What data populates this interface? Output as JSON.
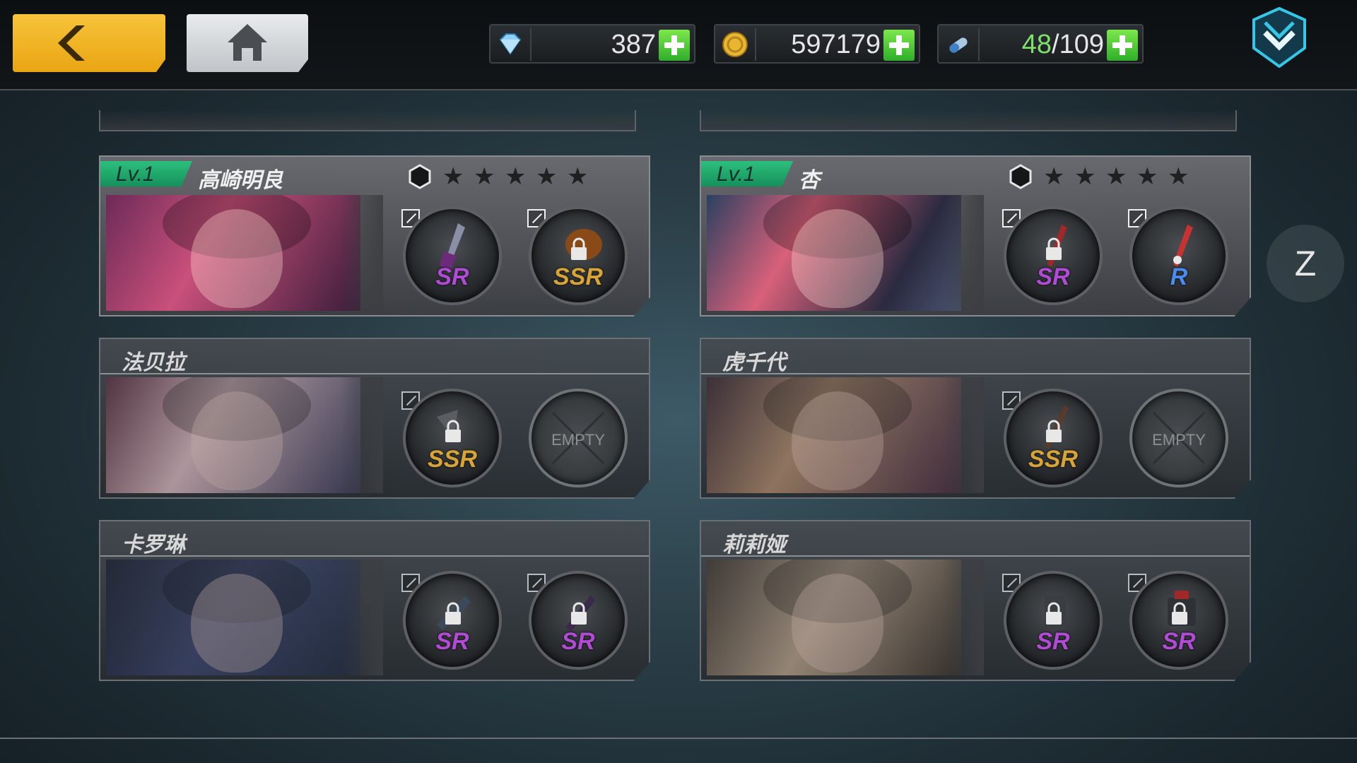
{
  "resources": {
    "gems": "387",
    "gold": "597179",
    "stamina_current": "48",
    "stamina_sep": "/109"
  },
  "characters": [
    {
      "name": "高崎明良",
      "level": "Lv.1",
      "featured": true,
      "slots": [
        {
          "rarity": "SR",
          "locked": false
        },
        {
          "rarity": "SSR",
          "locked": true
        }
      ]
    },
    {
      "name": "杏",
      "level": "Lv.1",
      "featured": true,
      "slots": [
        {
          "rarity": "SR",
          "locked": true
        },
        {
          "rarity": "R",
          "locked": false
        }
      ]
    },
    {
      "name": "法贝拉",
      "featured": false,
      "slots": [
        {
          "rarity": "SSR",
          "locked": true
        },
        {
          "empty_label": "EMPTY"
        }
      ]
    },
    {
      "name": "虎千代",
      "featured": false,
      "slots": [
        {
          "rarity": "SSR",
          "locked": true
        },
        {
          "empty_label": "EMPTY"
        }
      ]
    },
    {
      "name": "卡罗琳",
      "featured": false,
      "slots": [
        {
          "rarity": "SR",
          "locked": true
        },
        {
          "rarity": "SR",
          "locked": true
        }
      ]
    },
    {
      "name": "莉莉娅",
      "featured": false,
      "slots": [
        {
          "rarity": "SR",
          "locked": true
        },
        {
          "rarity": "SR",
          "locked": true
        }
      ]
    }
  ],
  "side_button": "Z",
  "icons": {
    "back": "chevron-left-icon",
    "home": "home-icon",
    "gem": "diamond-icon",
    "gold": "coin-icon",
    "stamina": "potion-icon",
    "menu": "shield-chevron-icon"
  }
}
